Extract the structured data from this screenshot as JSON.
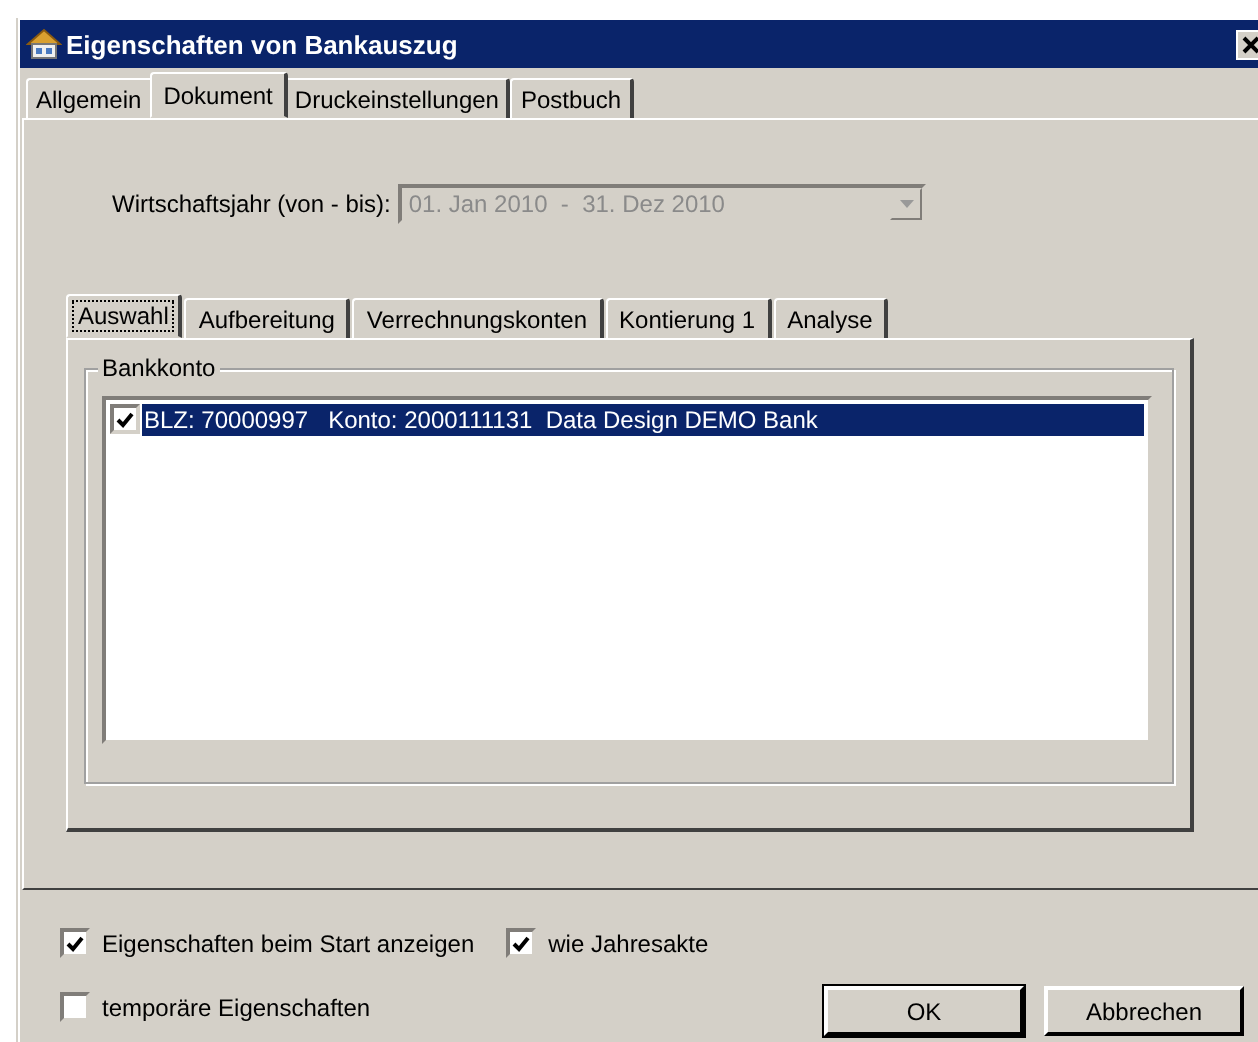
{
  "window": {
    "title": "Eigenschaften von Bankauszug"
  },
  "tabs": [
    {
      "label": "Allgemein",
      "selected": false
    },
    {
      "label": "Dokument",
      "selected": true
    },
    {
      "label": "Druckeinstellungen",
      "selected": false
    },
    {
      "label": "Postbuch",
      "selected": false
    }
  ],
  "fiscal_year": {
    "label": "Wirtschaftsjahr (von - bis):",
    "value": "01. Jan 2010  -  31. Dez 2010",
    "disabled": true
  },
  "subtabs": [
    {
      "label": "Auswahl",
      "selected": true
    },
    {
      "label": "Aufbereitung",
      "selected": false
    },
    {
      "label": "Verrechnungskonten",
      "selected": false
    },
    {
      "label": "Kontierung 1",
      "selected": false
    },
    {
      "label": "Analyse",
      "selected": false
    }
  ],
  "bank_account_group": {
    "title": "Bankkonto",
    "items": [
      {
        "text": "BLZ: 70000997   Konto: 2000111131  Data Design DEMO Bank",
        "checked": true,
        "selected": true
      }
    ]
  },
  "options": [
    {
      "label": "Eigenschaften beim Start anzeigen",
      "checked": true
    },
    {
      "label": "wie Jahresakte",
      "checked": true
    },
    {
      "label": "temporäre Eigenschaften",
      "checked": false
    }
  ],
  "buttons": [
    "OK",
    "Abbrechen"
  ]
}
